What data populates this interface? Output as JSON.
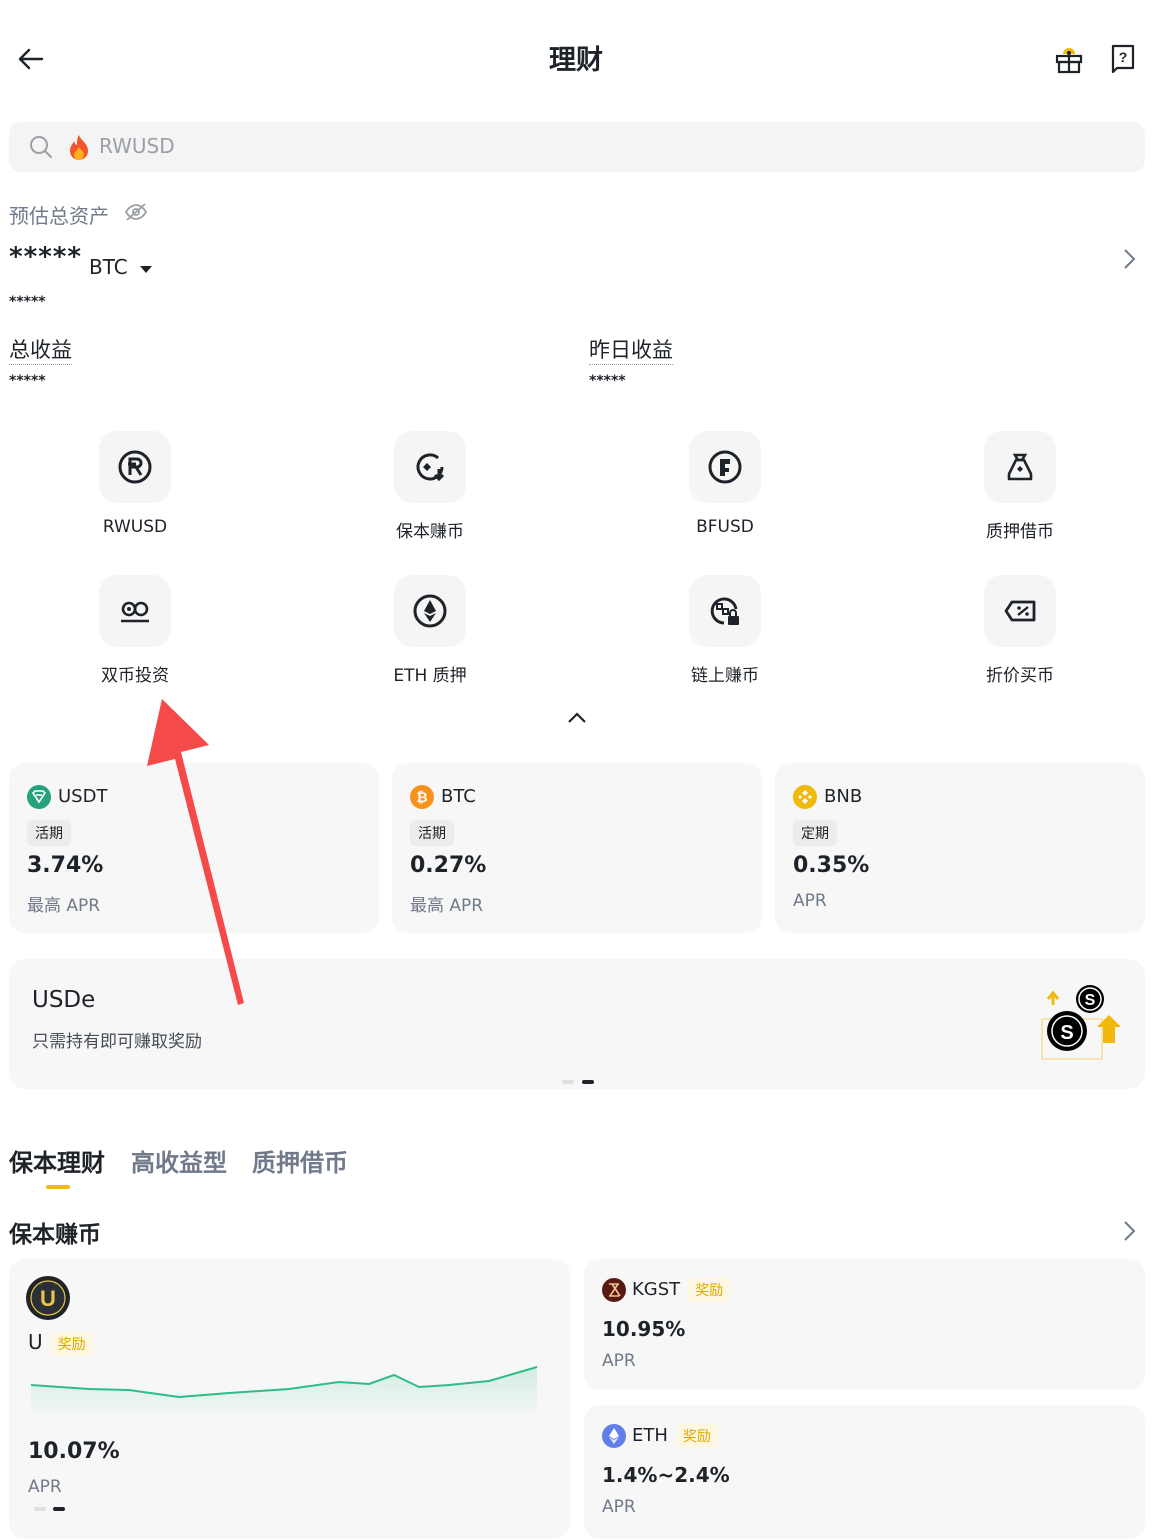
{
  "header": {
    "title": "理财",
    "back_icon": "back-arrow-icon",
    "gift_icon": "gift-icon",
    "help_icon": "help-icon"
  },
  "search": {
    "placeholder": "RWUSD",
    "icon": "search-icon",
    "hot_icon": "fire-icon"
  },
  "assets": {
    "label": "预估总资产",
    "hidden_value": "*****",
    "unit": "BTC",
    "sub_value": "*****",
    "total_profit_label": "总收益",
    "total_profit_value": "*****",
    "yesterday_profit_label": "昨日收益",
    "yesterday_profit_value": "*****"
  },
  "quick": [
    {
      "label": "RWUSD",
      "icon": "rwusd-icon"
    },
    {
      "label": "保本赚币",
      "icon": "principal-protected-icon"
    },
    {
      "label": "BFUSD",
      "icon": "bfusd-icon"
    },
    {
      "label": "质押借币",
      "icon": "loan-bag-icon"
    },
    {
      "label": "双币投资",
      "icon": "dual-investment-icon"
    },
    {
      "label": "ETH 质押",
      "icon": "eth-icon"
    },
    {
      "label": "链上赚币",
      "icon": "onchain-lock-icon"
    },
    {
      "label": "折价买币",
      "icon": "discount-ticket-icon"
    }
  ],
  "coins": [
    {
      "name": "USDT",
      "tag": "活期",
      "rate": "3.74%",
      "apr": "最高 APR",
      "color": "#26a17b"
    },
    {
      "name": "BTC",
      "tag": "活期",
      "rate": "0.27%",
      "apr": "最高 APR",
      "color": "#f7931a"
    },
    {
      "name": "BNB",
      "tag": "定期",
      "rate": "0.35%",
      "apr": "APR",
      "color": "#f0b90b"
    }
  ],
  "banner": {
    "title": "USDe",
    "subtitle": "只需持有即可赚取奖励"
  },
  "tabs": [
    "保本理财",
    "高收益型",
    "质押借币"
  ],
  "section": {
    "title": "保本赚币"
  },
  "products": {
    "u": {
      "name": "U",
      "bonus": "奖励",
      "rate": "10.07%",
      "apr": "APR"
    },
    "kgst": {
      "name": "KGST",
      "bonus": "奖励",
      "rate": "10.95%",
      "apr": "APR"
    },
    "eth": {
      "name": "ETH",
      "bonus": "奖励",
      "rate": "1.4%~2.4%",
      "apr": "APR"
    }
  },
  "colors": {
    "accent": "#f0b90b",
    "positive": "#2ebd85",
    "annotation": "#f44a4a"
  }
}
